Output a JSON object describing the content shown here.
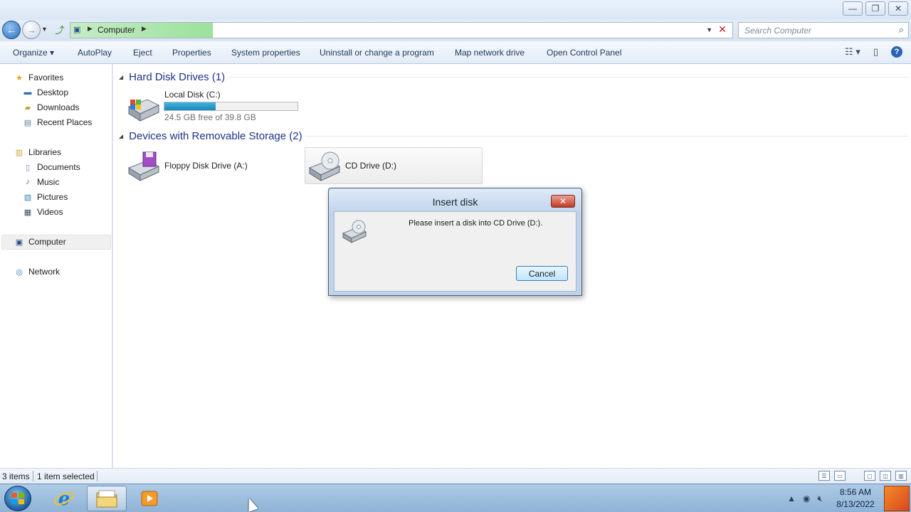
{
  "window": {
    "buttons": {
      "minimize": "—",
      "restore": "❐",
      "close": "✕"
    }
  },
  "address_bar": {
    "location": "Computer",
    "search_placeholder": "Search Computer"
  },
  "command_bar": {
    "items": [
      {
        "label": "Organize ▾",
        "name": "organize"
      },
      {
        "label": "AutoPlay",
        "name": "autoplay"
      },
      {
        "label": "Eject",
        "name": "eject"
      },
      {
        "label": "Properties",
        "name": "properties"
      },
      {
        "label": "System properties",
        "name": "system-properties"
      },
      {
        "label": "Uninstall or change a program",
        "name": "uninstall-program"
      },
      {
        "label": "Map network drive",
        "name": "map-network-drive"
      },
      {
        "label": "Open Control Panel",
        "name": "open-control-panel"
      }
    ]
  },
  "nav_pane": {
    "favorites": "Favorites",
    "desktop": "Desktop",
    "downloads": "Downloads",
    "recent_places": "Recent Places",
    "libraries": "Libraries",
    "documents": "Documents",
    "music": "Music",
    "pictures": "Pictures",
    "videos": "Videos",
    "computer": "Computer",
    "network": "Network"
  },
  "content": {
    "hard_disk_header": "Hard Disk Drives (1)",
    "removable_header": "Devices with Removable Storage (2)",
    "local_disk": {
      "name": "Local Disk (C:)",
      "free_text": "24.5 GB free of 39.8 GB",
      "used_fraction": 0.384
    },
    "floppy": {
      "name": "Floppy Disk Drive (A:)"
    },
    "cd_drive": {
      "name": "CD Drive (D:)"
    }
  },
  "dialog": {
    "title": "Insert disk",
    "message": "Please insert a disk into CD Drive (D:).",
    "cancel_label": "Cancel"
  },
  "status_bar": {
    "items_count": "3 items",
    "selection": "1 item selected"
  },
  "taskbar": {
    "time": "8:56 AM",
    "date": "8/13/2022"
  },
  "colors": {
    "accent": "#1e3287",
    "usage_fill": "#1a86b9",
    "dialog_close": "#c23a25"
  }
}
